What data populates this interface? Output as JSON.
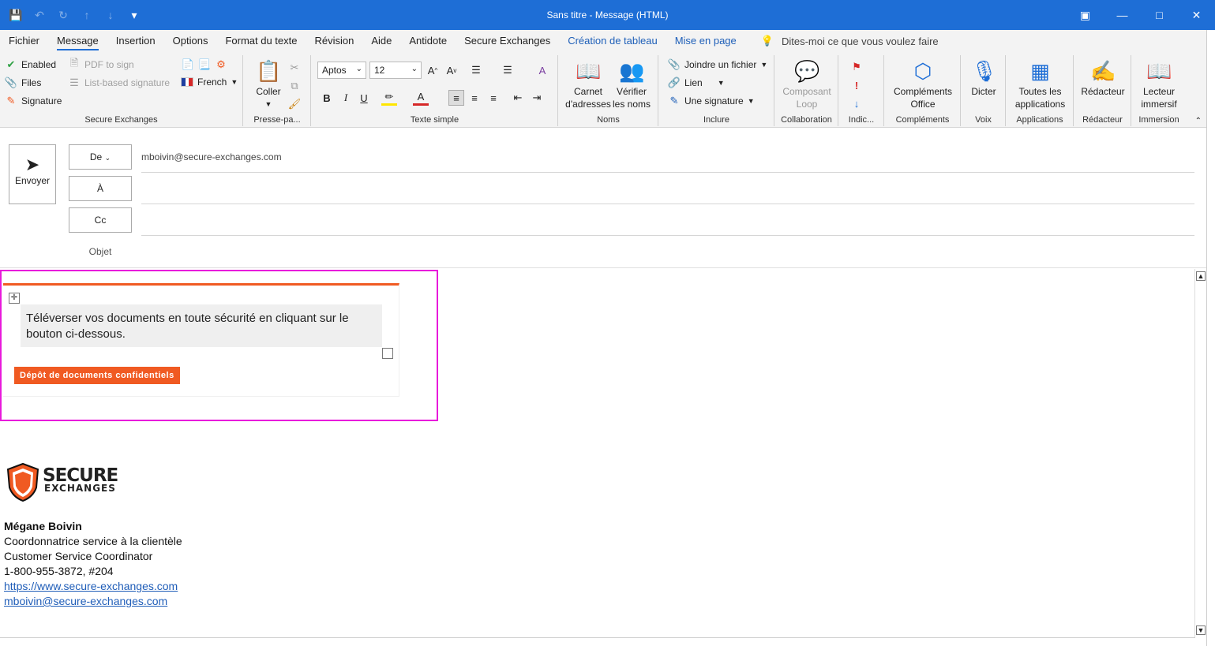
{
  "window": {
    "title": "Sans titre  -  Message (HTML)"
  },
  "menu": {
    "tabs": [
      "Fichier",
      "Message",
      "Insertion",
      "Options",
      "Format du texte",
      "Révision",
      "Aide",
      "Antidote",
      "Secure Exchanges",
      "Création de tableau",
      "Mise en page"
    ],
    "active": "Message",
    "tell_me": "Dites-moi ce que vous voulez faire"
  },
  "ribbon": {
    "secure_exchanges": {
      "enabled": "Enabled",
      "files": "Files",
      "signature": "Signature",
      "pdf_to_sign": "PDF to sign",
      "list_based_signature": "List-based signature",
      "language": "French",
      "label": "Secure Exchanges"
    },
    "clipboard": {
      "paste": "Coller",
      "label": "Presse-pa..."
    },
    "text": {
      "font": "Aptos",
      "size": "12",
      "label": "Texte simple"
    },
    "names": {
      "address_book": "Carnet d'adresses",
      "check_names": "Vérifier les noms",
      "label": "Noms"
    },
    "include": {
      "attach": "Joindre un fichier",
      "link": "Lien",
      "signature": "Une signature",
      "label": "Inclure"
    },
    "collab": {
      "loop": "Composant Loop",
      "label": "Collaboration"
    },
    "tags": {
      "label": "Indic..."
    },
    "addins": {
      "office_addins": "Compléments Office",
      "label": "Compléments"
    },
    "voice": {
      "dictate": "Dicter",
      "label": "Voix"
    },
    "apps": {
      "all_apps": "Toutes les applications",
      "label": "Applications"
    },
    "editor": {
      "editor": "Rédacteur",
      "label": "Rédacteur"
    },
    "immersive": {
      "reader": "Lecteur immersif",
      "label": "Immersion"
    }
  },
  "compose": {
    "send": "Envoyer",
    "from_label": "De",
    "from_value": "mboivin@secure-exchanges.com",
    "to_label": "À",
    "cc_label": "Cc",
    "subject_label": "Objet"
  },
  "body": {
    "message": "Téléverser vos documents en toute sécurité en cliquant sur le bouton ci-dessous.",
    "button": "Dépôt de documents confidentiels",
    "logo_line1": "SECURE",
    "logo_line2": "EXCHANGES",
    "sig_name": "Mégane Boivin",
    "sig_title_fr": "Coordonnatrice service à la clientèle",
    "sig_title_en": "Customer Service Coordinator",
    "sig_phone": "1-800-955-3872, #204",
    "sig_web": "https://www.secure-exchanges.com",
    "sig_email": "mboivin@secure-exchanges.com"
  },
  "colors": {
    "titlebar": "#1e6ed6",
    "accent": "#f05a22",
    "highlight_frame": "#e81adb"
  }
}
